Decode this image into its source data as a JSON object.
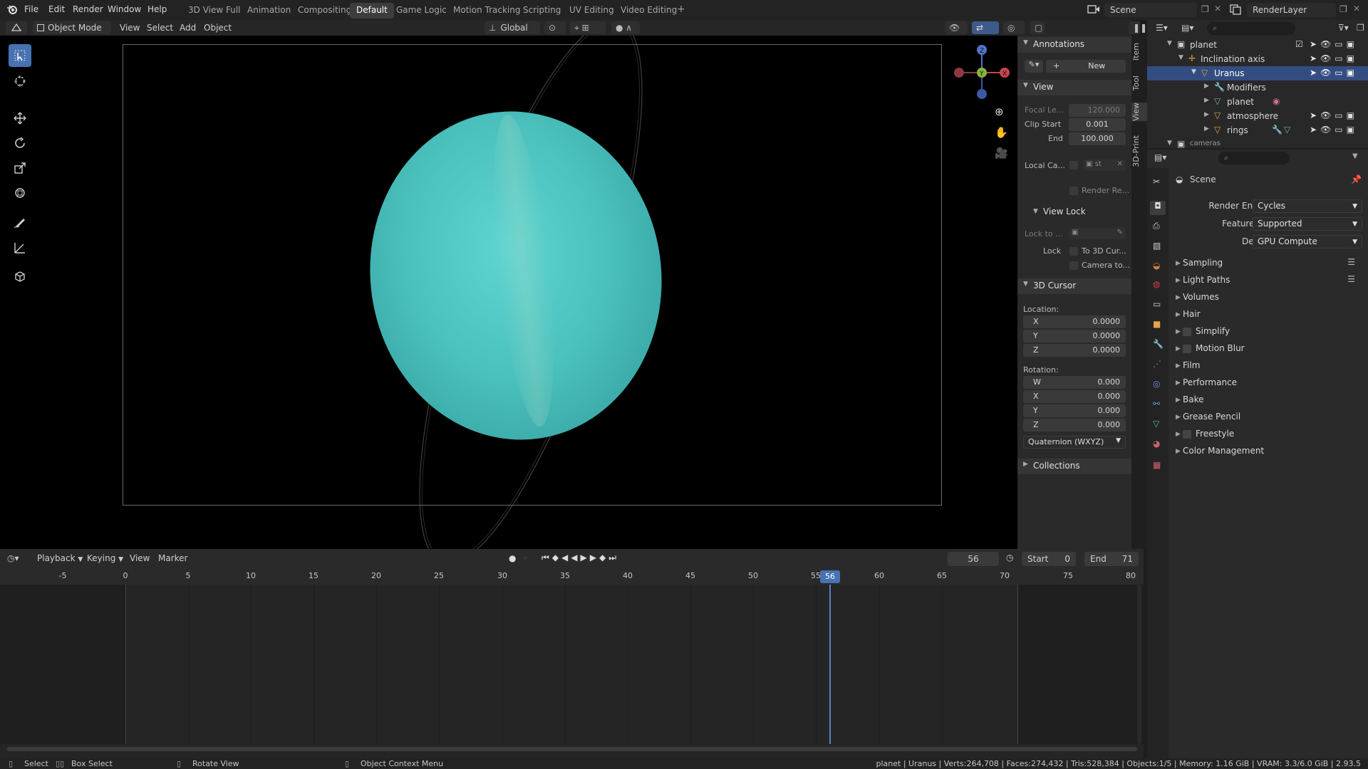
{
  "menu": {
    "items": [
      "File",
      "Edit",
      "Render",
      "Window",
      "Help"
    ]
  },
  "workspaces": [
    "3D View Full",
    "Animation",
    "Compositing",
    "Default",
    "Game Logic",
    "Motion Tracking",
    "Scripting",
    "UV Editing",
    "Video Editing"
  ],
  "active_workspace": "Default",
  "scene_name": "Scene",
  "view_layer": "RenderLayer",
  "viewport_header": {
    "mode": "Object Mode",
    "menus": [
      "View",
      "Select",
      "Add",
      "Object"
    ],
    "orientation": "Global"
  },
  "npanel": {
    "tabs": [
      "Item",
      "Tool",
      "View",
      "3D-Print"
    ],
    "annotations": {
      "title": "Annotations",
      "new_label": "New"
    },
    "view": {
      "title": "View",
      "focal_label": "Focal Le...",
      "focal_value": "120.000",
      "clip_start_label": "Clip Start",
      "clip_start_value": "0.001",
      "end_label": "End",
      "end_value": "100.000",
      "local_camera_label": "Local Ca...",
      "local_camera_value": "st",
      "render_region_label": "Render Re..."
    },
    "view_lock": {
      "title": "View Lock",
      "lock_to_label": "Lock to ...",
      "lock_label": "Lock",
      "to_3d_cursor": "To 3D Cur...",
      "camera_to": "Camera to..."
    },
    "cursor": {
      "title": "3D Cursor",
      "location_label": "Location:",
      "loc": [
        {
          "k": "X",
          "v": "0.0000"
        },
        {
          "k": "Y",
          "v": "0.0000"
        },
        {
          "k": "Z",
          "v": "0.0000"
        }
      ],
      "rotation_label": "Rotation:",
      "rot": [
        {
          "k": "W",
          "v": "0.000"
        },
        {
          "k": "X",
          "v": "0.000"
        },
        {
          "k": "Y",
          "v": "0.000"
        },
        {
          "k": "Z",
          "v": "0.000"
        }
      ],
      "rotation_mode": "Quaternion (WXYZ)"
    },
    "collections": {
      "title": "Collections"
    }
  },
  "outliner": {
    "rows": [
      {
        "label": "planet",
        "selected": false
      },
      {
        "label": "Inclination axis",
        "selected": false
      },
      {
        "label": "Uranus",
        "selected": true
      },
      {
        "label": "Modifiers",
        "selected": false
      },
      {
        "label": "planet",
        "selected": false
      },
      {
        "label": "atmosphere",
        "selected": false
      },
      {
        "label": "rings",
        "selected": false
      },
      {
        "label": "cameras",
        "selected": false
      }
    ]
  },
  "properties": {
    "context": "Scene",
    "render_engine_label": "Render Engine",
    "render_engine": "Cycles",
    "feature_set_label": "Feature Set",
    "feature_set": "Supported",
    "device_label": "Device",
    "device": "GPU Compute",
    "panels": [
      "Sampling",
      "Light Paths",
      "Volumes",
      "Hair",
      "Simplify",
      "Motion Blur",
      "Film",
      "Performance",
      "Bake",
      "Grease Pencil",
      "Freestyle",
      "Color Management"
    ]
  },
  "timeline": {
    "menus": [
      "Playback",
      "Keying",
      "View",
      "Marker"
    ],
    "current_frame": "56",
    "start_label": "Start",
    "start": "0",
    "end_label": "End",
    "end": "71",
    "ruler": [
      "-5",
      "0",
      "5",
      "10",
      "15",
      "20",
      "25",
      "30",
      "35",
      "40",
      "45",
      "50",
      "55",
      "60",
      "65",
      "70",
      "75",
      "80"
    ]
  },
  "statusbar": {
    "select": "Select",
    "box_select": "Box Select",
    "rotate_view": "Rotate View",
    "context_menu": "Object Context Menu",
    "stats": "planet | Uranus | Verts:264,708 | Faces:274,432 | Tris:528,384 | Objects:1/5 | Memory: 1.16 GiB | VRAM: 3.3/6.0 GiB | 2.93.5"
  },
  "colors": {
    "accent": "#4772b3",
    "planet": "#4fc7c4",
    "selected_row": "#334d80",
    "playhead": "#5680c2"
  }
}
